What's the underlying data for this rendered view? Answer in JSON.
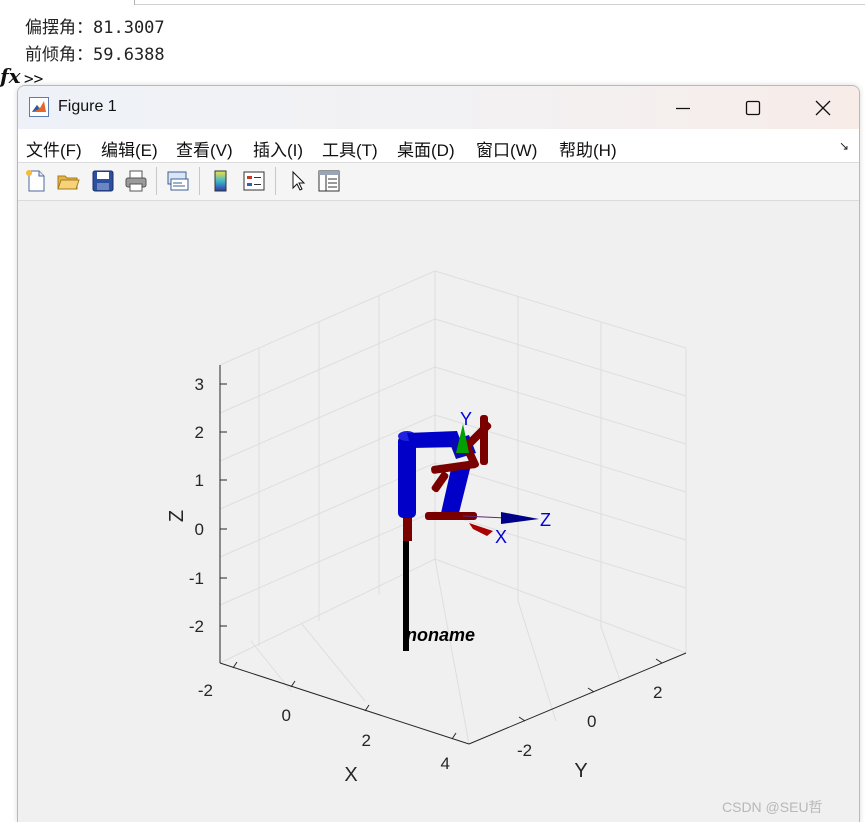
{
  "command_window": {
    "output_line_1": "偏摆角：81.3007",
    "output_line_2": "前倾角：59.6388",
    "fx_symbol": "fx",
    "prompt": ">>"
  },
  "figure": {
    "title": "Figure 1",
    "window_controls": {
      "minimize": "─",
      "maximize": "☐",
      "close": "✕"
    },
    "menu": [
      "文件(F)",
      "编辑(E)",
      "查看(V)",
      "插入(I)",
      "工具(T)",
      "桌面(D)",
      "窗口(W)",
      "帮助(H)"
    ],
    "dock_arrow": "↘",
    "toolbar_icons": [
      "new-figure-icon",
      "open-file-icon",
      "save-icon",
      "print-icon",
      "link-plot-icon",
      "insert-colorbar-icon",
      "insert-legend-icon",
      "edit-plot-arrow-icon",
      "property-inspector-icon"
    ]
  },
  "plot": {
    "axis_labels": {
      "x": "X",
      "y": "Y",
      "z": "Z"
    },
    "z_ticks": [
      "3",
      "2",
      "1",
      "0",
      "-1",
      "-2"
    ],
    "x_ticks": [
      "-2",
      "0",
      "2",
      "4"
    ],
    "y_ticks": [
      "-2",
      "0",
      "2"
    ],
    "robot_name": "noname",
    "frame_labels": {
      "x": "X",
      "y": "Y",
      "z": "Z"
    },
    "colors": {
      "link": "#0000c8",
      "joint": "#7a0000",
      "base": "#000000",
      "frame_label": "#0000dd"
    }
  },
  "watermark": "CSDN @SEU哲"
}
